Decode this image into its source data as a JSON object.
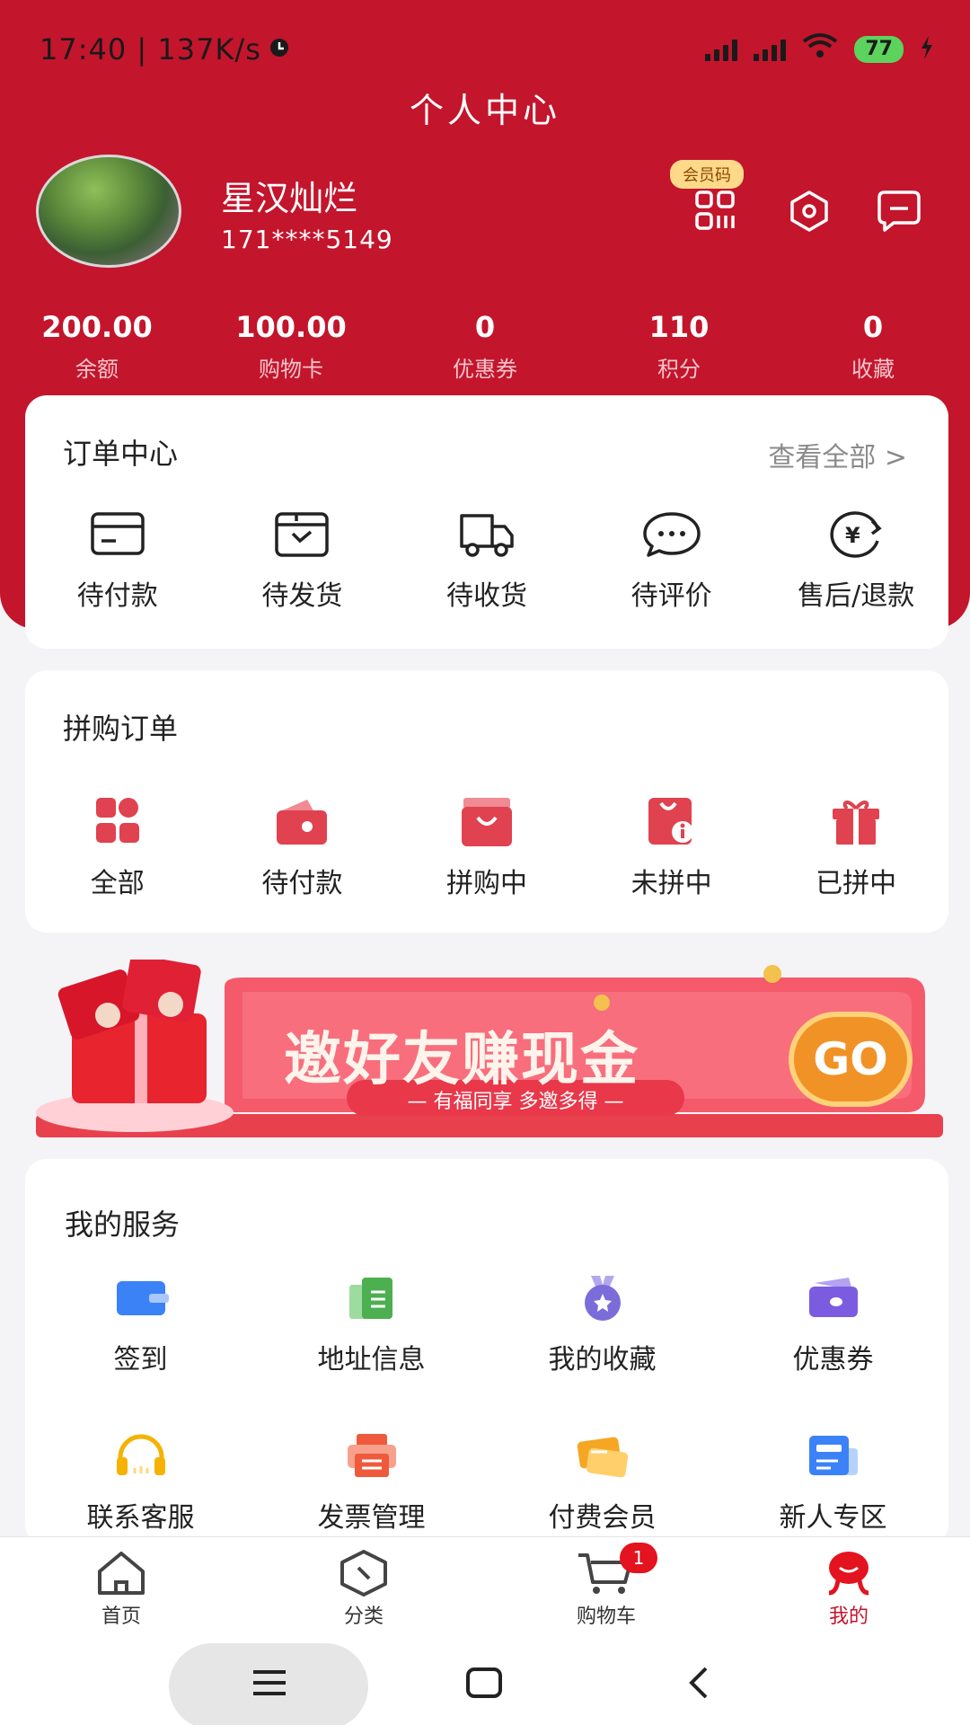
{
  "status": {
    "time": "17:40 | 137K/s",
    "battery": "77"
  },
  "header": {
    "title": "个人中心",
    "username": "星汉灿烂",
    "phone": "171****5149",
    "member_code": "会员码"
  },
  "stats": [
    {
      "value": "200.00",
      "label": "余额"
    },
    {
      "value": "100.00",
      "label": "购物卡"
    },
    {
      "value": "0",
      "label": "优惠券"
    },
    {
      "value": "110",
      "label": "积分"
    },
    {
      "value": "0",
      "label": "收藏"
    }
  ],
  "orders": {
    "title": "订单中心",
    "view_all": "查看全部 >",
    "items": [
      {
        "label": "待付款",
        "icon": "card-icon"
      },
      {
        "label": "待发货",
        "icon": "box-icon"
      },
      {
        "label": "待收货",
        "icon": "truck-icon"
      },
      {
        "label": "待评价",
        "icon": "chat-icon"
      },
      {
        "label": "售后/退款",
        "icon": "refund-icon"
      }
    ]
  },
  "group": {
    "title": "拼购订单",
    "items": [
      {
        "label": "全部",
        "icon": "grid-icon"
      },
      {
        "label": "待付款",
        "icon": "wallet-icon"
      },
      {
        "label": "拼购中",
        "icon": "bag-icon"
      },
      {
        "label": "未拼中",
        "icon": "info-icon"
      },
      {
        "label": "已拼中",
        "icon": "gift-icon"
      }
    ]
  },
  "banner": {
    "headline": "邀好友赚现金",
    "go": "GO",
    "sub": "— 有福同享 多邀多得 —"
  },
  "services": {
    "title": "我的服务",
    "items": [
      {
        "label": "签到",
        "icon": "card-blue-icon",
        "color": "#3b82f6"
      },
      {
        "label": "地址信息",
        "icon": "document-green-icon",
        "color": "#4caf50"
      },
      {
        "label": "我的收藏",
        "icon": "medal-purple-icon",
        "color": "#7b6cd9"
      },
      {
        "label": "优惠券",
        "icon": "ticket-purple-icon",
        "color": "#7b5ce0"
      },
      {
        "label": "联系客服",
        "icon": "headset-icon",
        "color": "#f5b200"
      },
      {
        "label": "发票管理",
        "icon": "printer-icon",
        "color": "#ef5a3c"
      },
      {
        "label": "付费会员",
        "icon": "vip-card-icon",
        "color": "#f5a623"
      },
      {
        "label": "新人专区",
        "icon": "newbie-card-icon",
        "color": "#3b82f6"
      }
    ]
  },
  "tabbar": {
    "items": [
      {
        "label": "首页",
        "icon": "home-icon"
      },
      {
        "label": "分类",
        "icon": "category-icon"
      },
      {
        "label": "购物车",
        "icon": "cart-icon",
        "badge": "1"
      },
      {
        "label": "我的",
        "icon": "profile-icon"
      }
    ]
  },
  "colors": {
    "brand": "#c3152c",
    "accent": "#e3131f"
  }
}
